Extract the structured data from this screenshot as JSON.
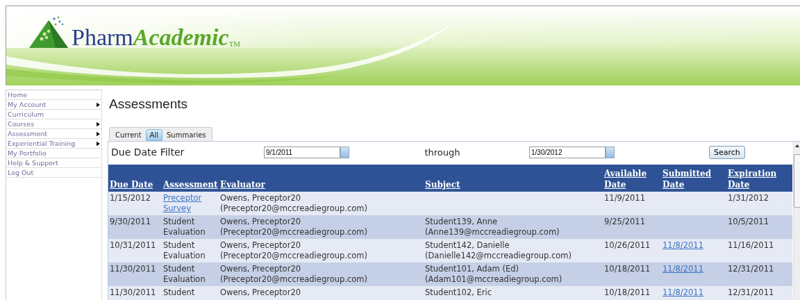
{
  "logo": {
    "first": "Pharm",
    "second": "Academic",
    "mark": "TM"
  },
  "sidebar": {
    "items": [
      {
        "label": "Home",
        "submenu": false
      },
      {
        "label": "My Account",
        "submenu": true
      },
      {
        "label": "Curriculum",
        "submenu": false
      },
      {
        "label": "Courses",
        "submenu": true
      },
      {
        "label": "Assessment",
        "submenu": true
      },
      {
        "label": "Experiential Training",
        "submenu": true
      },
      {
        "label": "My Portfolio",
        "submenu": false
      },
      {
        "label": "Help & Support",
        "submenu": false
      },
      {
        "label": "Log Out",
        "submenu": false
      }
    ]
  },
  "page_title": "Assessments",
  "tabs": [
    {
      "label": "Current",
      "selected": false
    },
    {
      "label": "All",
      "selected": true
    },
    {
      "label": "Summaries",
      "selected": false
    }
  ],
  "filter": {
    "label": "Due Date Filter",
    "from": "9/1/2011",
    "through_label": "through",
    "to": "1/30/2012",
    "button": "Search"
  },
  "table": {
    "columns": [
      "Due Date",
      "Assessment",
      "Evaluator",
      "Subject",
      "Available Date",
      "Submitted Date",
      "Expiration Date"
    ],
    "rows": [
      {
        "due_date": "1/15/2012",
        "assessment": "Preceptor Survey",
        "assessment_link": true,
        "evaluator": [
          "Owens, Preceptor20",
          "(Preceptor20@mccreadiegroup.com)"
        ],
        "subject": [],
        "available": "11/9/2011",
        "submitted": "",
        "expiration": "1/31/2012"
      },
      {
        "due_date": "9/30/2011",
        "assessment": "Student Evaluation",
        "assessment_link": false,
        "evaluator": [
          "Owens, Preceptor20",
          "(Preceptor20@mccreadiegroup.com)"
        ],
        "subject": [
          "Student139, Anne",
          "(Anne139@mccreadiegroup.com)"
        ],
        "available": "9/25/2011",
        "submitted": "",
        "expiration": "10/5/2011"
      },
      {
        "due_date": "10/31/2011",
        "assessment": "Student Evaluation",
        "assessment_link": false,
        "evaluator": [
          "Owens, Preceptor20",
          "(Preceptor20@mccreadiegroup.com)"
        ],
        "subject": [
          "Student142, Danielle",
          "(Danielle142@mccreadiegroup.com)"
        ],
        "available": "10/26/2011",
        "submitted": "11/8/2011",
        "submitted_link": true,
        "expiration": "11/16/2011"
      },
      {
        "due_date": "11/30/2011",
        "assessment": "Student Evaluation",
        "assessment_link": false,
        "evaluator": [
          "Owens, Preceptor20",
          "(Preceptor20@mccreadiegroup.com)"
        ],
        "subject": [
          "Student101, Adam (Ed)",
          "(Adam101@mccreadiegroup.com)"
        ],
        "available": "10/18/2011",
        "submitted": "11/8/2011",
        "submitted_link": true,
        "expiration": "12/31/2011"
      },
      {
        "due_date": "11/30/2011",
        "assessment": "Student",
        "assessment_link": false,
        "evaluator": [
          "Owens, Preceptor20"
        ],
        "subject": [
          "Student102, Eric"
        ],
        "available": "10/18/2011",
        "submitted": "11/8/2011",
        "submitted_link": true,
        "expiration": "12/31/2011"
      }
    ]
  }
}
